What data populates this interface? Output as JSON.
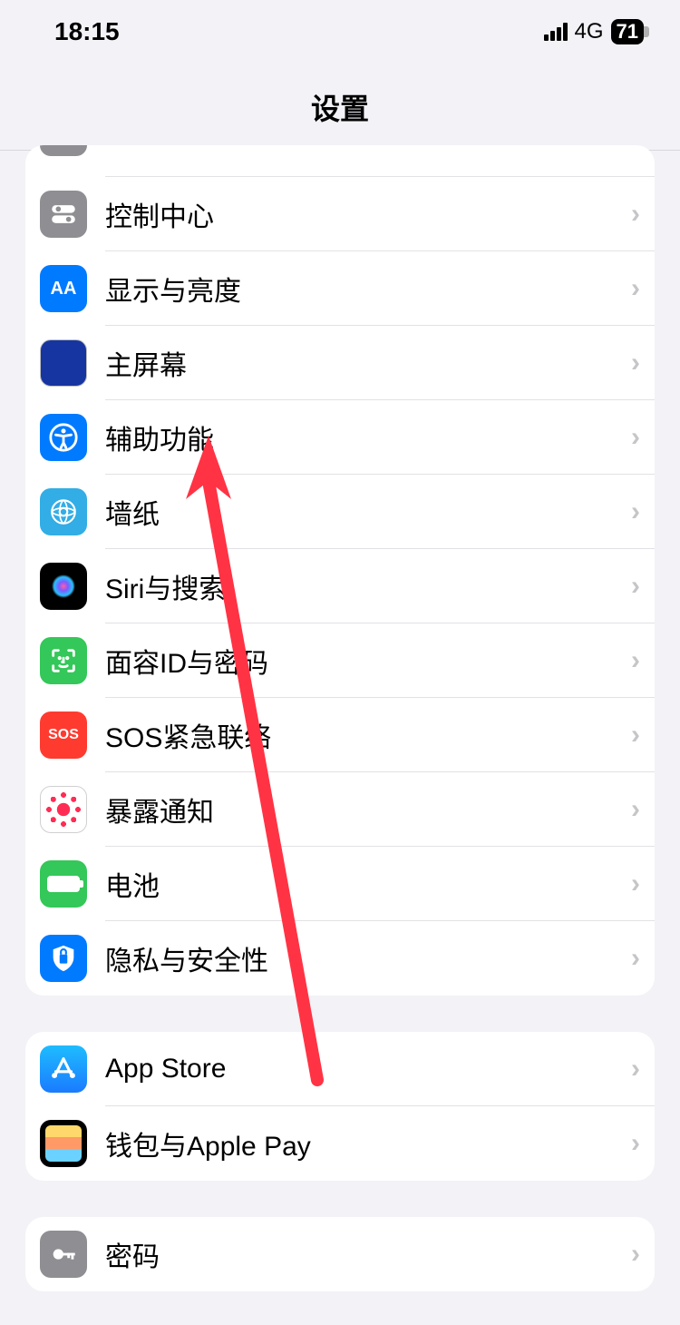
{
  "status": {
    "time": "18:15",
    "network": "4G",
    "battery": "71"
  },
  "header": {
    "title": "设置"
  },
  "groups": [
    {
      "rows": [
        {
          "icon": "partial",
          "label": ""
        },
        {
          "icon": "control-center",
          "label": "控制中心"
        },
        {
          "icon": "display-brightness",
          "label": "显示与亮度"
        },
        {
          "icon": "home-screen",
          "label": "主屏幕"
        },
        {
          "icon": "accessibility",
          "label": "辅助功能"
        },
        {
          "icon": "wallpaper",
          "label": "墙纸"
        },
        {
          "icon": "siri-search",
          "label": "Siri与搜索"
        },
        {
          "icon": "face-id",
          "label": "面容ID与密码"
        },
        {
          "icon": "sos",
          "label": "SOS紧急联络"
        },
        {
          "icon": "exposure",
          "label": "暴露通知"
        },
        {
          "icon": "battery",
          "label": "电池"
        },
        {
          "icon": "privacy",
          "label": "隐私与安全性"
        }
      ]
    },
    {
      "rows": [
        {
          "icon": "app-store",
          "label": "App Store"
        },
        {
          "icon": "wallet",
          "label": "钱包与Apple Pay"
        }
      ]
    },
    {
      "rows": [
        {
          "icon": "passwords",
          "label": "密码"
        }
      ]
    }
  ],
  "sos_text": "SOS"
}
